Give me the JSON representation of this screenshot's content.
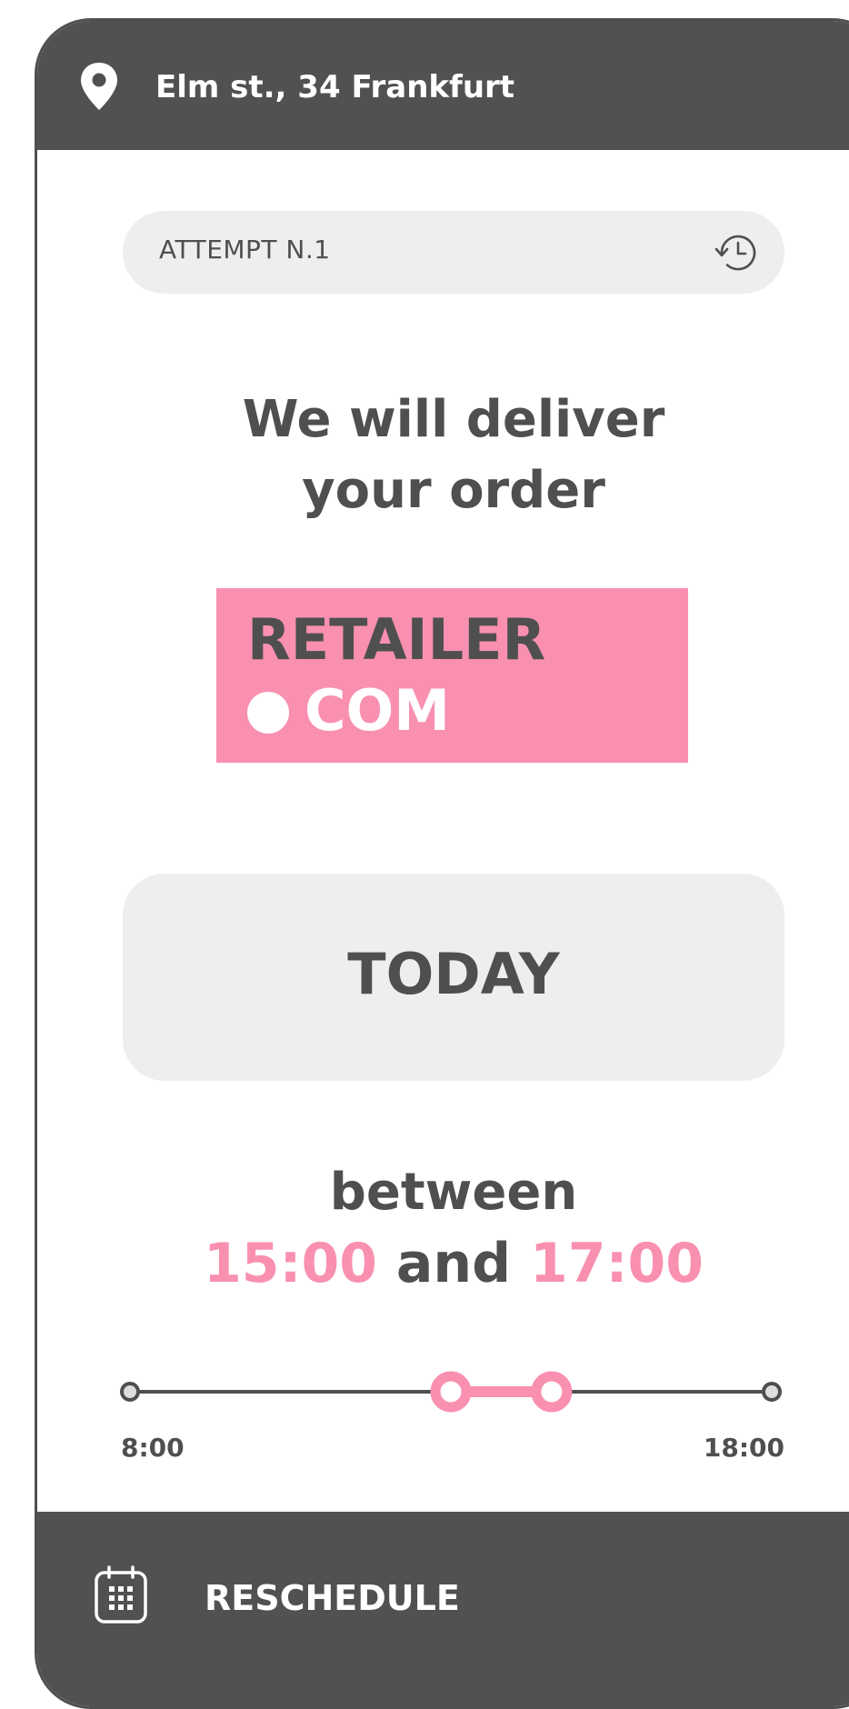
{
  "header": {
    "address": "Elm st., 34 Frankfurt",
    "icon": "map-pin-icon"
  },
  "attempt": {
    "label": "ATTEMPT N.1",
    "icon": "history-icon"
  },
  "headline": {
    "line1": "We will deliver",
    "line2": "your order"
  },
  "retailer_logo": {
    "line1": "RETAILER",
    "line2": "COM"
  },
  "delivery_day": {
    "label": "TODAY"
  },
  "time_window": {
    "prefix": "between",
    "start": "15:00",
    "connector": "and",
    "end": "17:00"
  },
  "time_slider": {
    "min_label": "8:00",
    "max_label": "18:00",
    "range_start_fraction": 0.5,
    "range_end_fraction": 0.657
  },
  "footer": {
    "reschedule_label": "RESCHEDULE",
    "icon": "calendar-icon"
  },
  "colors": {
    "dark": "#515151",
    "text": "#4f4f4f",
    "accent": "#f990b0",
    "surface": "#eeeeee"
  }
}
